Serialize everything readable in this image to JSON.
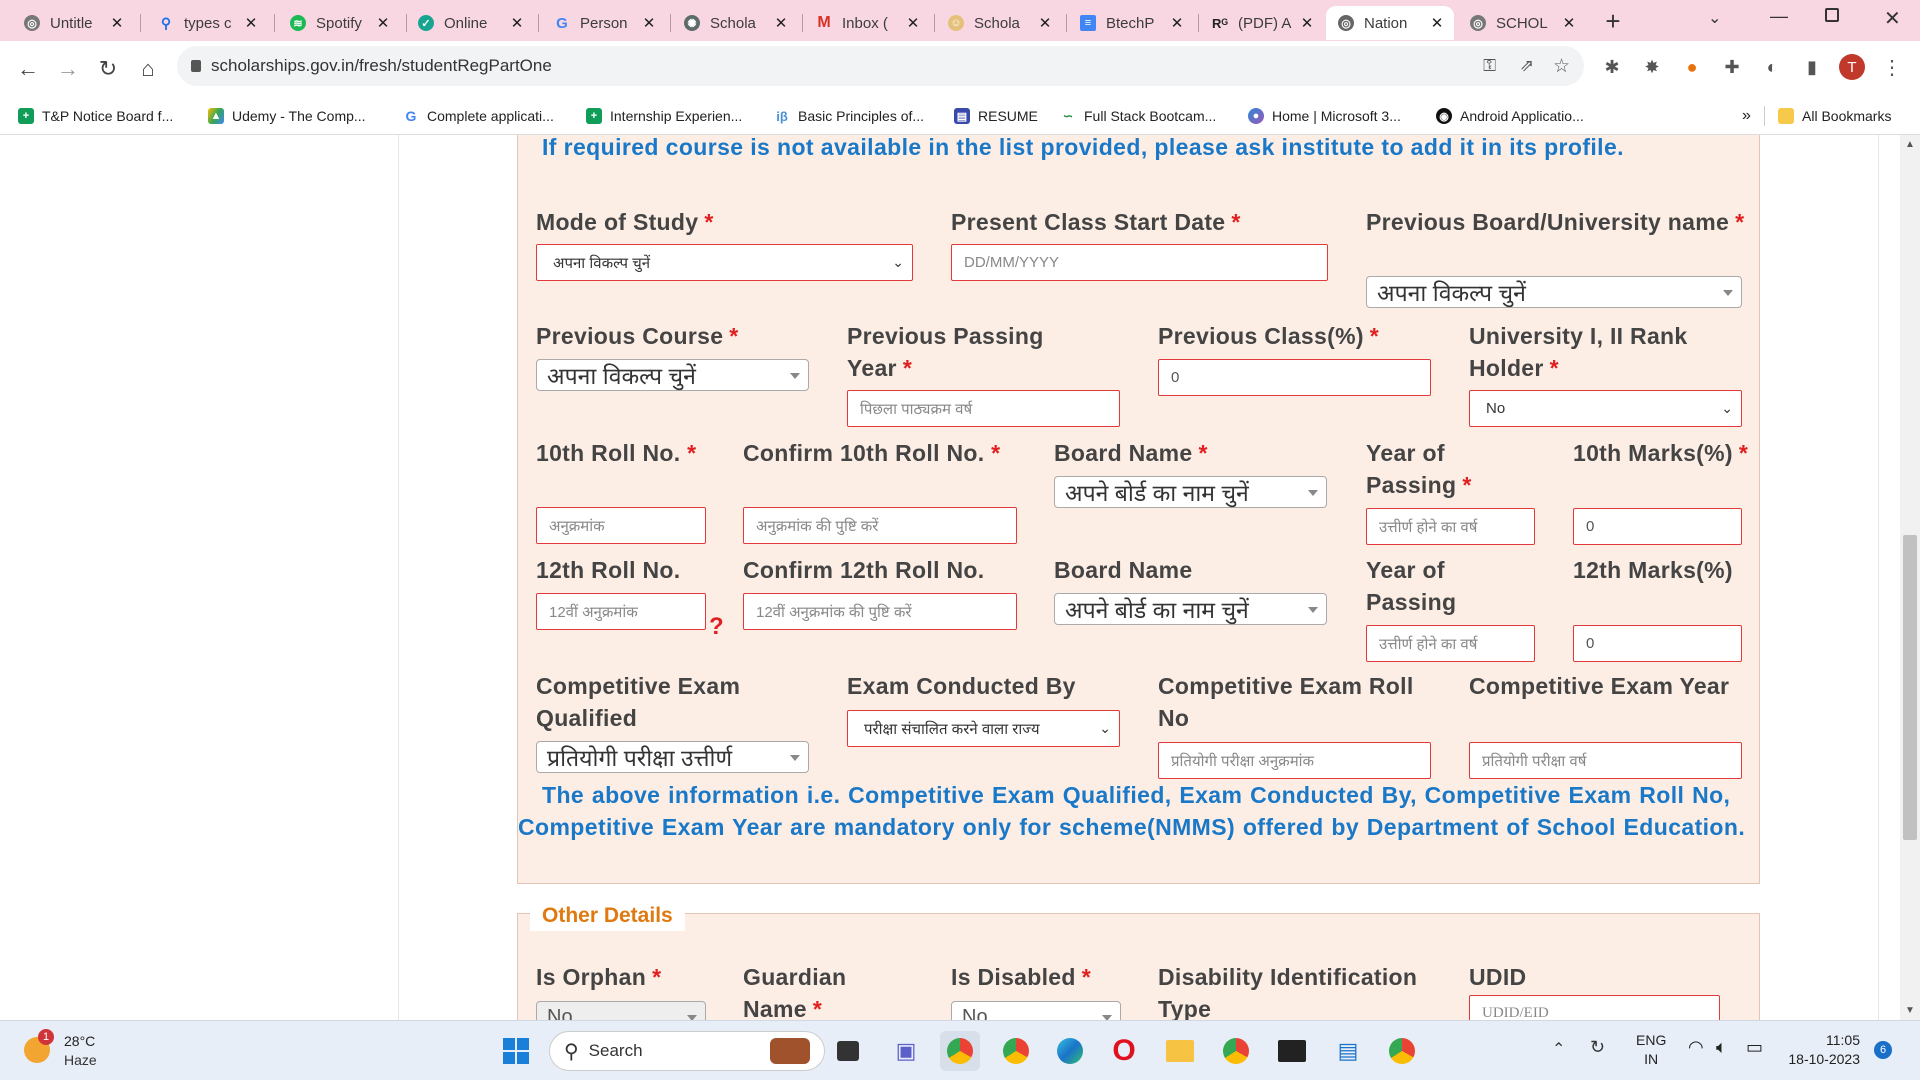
{
  "tabs": [
    {
      "title": "Untitle",
      "icon": "globe-icon"
    },
    {
      "title": "types c",
      "icon": "search-icon"
    },
    {
      "title": "Spotify",
      "icon": "spotify-icon"
    },
    {
      "title": "Online",
      "icon": "online-icon"
    },
    {
      "title": "Person",
      "icon": "google-icon"
    },
    {
      "title": "Schola",
      "icon": "chatgpt-icon"
    },
    {
      "title": "Inbox (",
      "icon": "gmail-icon"
    },
    {
      "title": "Schola",
      "icon": "scholar-icon"
    },
    {
      "title": "BtechP",
      "icon": "docs-icon"
    },
    {
      "title": "(PDF) A",
      "icon": "researchgate-icon"
    },
    {
      "title": "Nation",
      "icon": "globe-icon",
      "active": true
    },
    {
      "title": "SCHOL",
      "icon": "globe-icon"
    }
  ],
  "address": {
    "url": "scholarships.gov.in/fresh/studentRegPartOne"
  },
  "profile_initial": "T",
  "bookmarks": [
    {
      "label": "T&P Notice Board f...",
      "icon": "sheets-icon"
    },
    {
      "label": "Udemy - The Comp...",
      "icon": "drive-icon"
    },
    {
      "label": "Complete applicati...",
      "icon": "google-icon"
    },
    {
      "label": "Internship Experien...",
      "icon": "sheets-icon"
    },
    {
      "label": "Basic Principles of...",
      "icon": "ib-icon"
    },
    {
      "label": "RESUME",
      "icon": "resume-icon"
    },
    {
      "label": "Full Stack Bootcam...",
      "icon": "geeks-icon"
    },
    {
      "label": "Home | Microsoft 3...",
      "icon": "microsoft-icon"
    },
    {
      "label": "Android Applicatio...",
      "icon": "github-icon"
    }
  ],
  "all_bookmarks": "All Bookmarks",
  "bookmarks_overflow": "»",
  "form": {
    "course_note": "If required course is not available in the list provided, please ask institute to add it in its profile.",
    "required_mark": "*",
    "mode_of_study": {
      "label": "Mode of Study",
      "value": "अपना विकल्प चुनें"
    },
    "present_class_start": {
      "label": "Present Class Start Date",
      "placeholder": "DD/MM/YYYY"
    },
    "prev_board": {
      "label": "Previous Board/University name",
      "value": "अपना विकल्प चुनें"
    },
    "prev_course": {
      "label": "Previous Course",
      "value": "अपना विकल्प चुनें"
    },
    "prev_passing_year": {
      "label": "Previous Passing Year",
      "placeholder": "पिछला पाठ्यक्रम वर्ष"
    },
    "prev_class_pct": {
      "label": "Previous Class(%)",
      "value": "0"
    },
    "rank_holder": {
      "label": "University I, II Rank Holder",
      "value": "No"
    },
    "roll10": {
      "label": "10th Roll No.",
      "placeholder": "अनुक्रमांक"
    },
    "confirm_roll10": {
      "label": "Confirm 10th Roll No.",
      "placeholder": "अनुक्रमांक की पुष्टि करें"
    },
    "board10": {
      "label": "Board Name",
      "value": "अपने बोर्ड का नाम चुनें"
    },
    "year10": {
      "label": "Year of Passing",
      "placeholder": "उत्तीर्ण होने का वर्ष"
    },
    "marks10": {
      "label": "10th Marks(%)",
      "value": "0"
    },
    "roll12": {
      "label": "12th Roll No.",
      "placeholder": "12वीं अनुक्रमांक"
    },
    "help_mark": "?",
    "confirm_roll12": {
      "label": "Confirm 12th Roll No.",
      "placeholder": "12वीं अनुक्रमांक की पुष्टि करें"
    },
    "board12": {
      "label": "Board Name",
      "value": "अपने बोर्ड का नाम चुनें"
    },
    "year12": {
      "label": "Year of Passing",
      "placeholder": "उत्तीर्ण होने का वर्ष"
    },
    "marks12": {
      "label": "12th Marks(%)",
      "value": "0"
    },
    "comp_exam": {
      "label": "Competitive Exam Qualified",
      "value": "प्रतियोगी परीक्षा उत्तीर्ण"
    },
    "exam_by": {
      "label": "Exam Conducted By",
      "value": "परीक्षा संचालित करने वाला राज्य"
    },
    "comp_roll": {
      "label": "Competitive Exam Roll No",
      "placeholder": "प्रतियोगी परीक्षा अनुक्रमांक"
    },
    "comp_year": {
      "label": "Competitive Exam Year",
      "placeholder": "प्रतियोगी परीक्षा वर्ष"
    },
    "comp_note": "The above information i.e. Competitive Exam Qualified, Exam Conducted By, Competitive Exam Roll No, Competitive Exam Year are mandatory only for scheme(NMMS) offered by Department of School Education."
  },
  "other": {
    "legend": "Other Details",
    "is_orphan": {
      "label": "Is Orphan",
      "value": "No"
    },
    "guardian_name": {
      "label": "Guardian Name"
    },
    "is_disabled": {
      "label": "Is Disabled",
      "value": "No"
    },
    "disability_type": {
      "label": "Disability Identification Type"
    },
    "udid": {
      "label": "UDID",
      "placeholder": "UDID/EID"
    }
  },
  "taskbar": {
    "weather_temp": "28°C",
    "weather_desc": "Haze",
    "weather_badge": "1",
    "search": "Search",
    "lang1": "ENG",
    "lang2": "IN",
    "time": "11:05",
    "date": "18-10-2023",
    "notif": "6"
  },
  "colors": {
    "note_blue": "#1978c8",
    "legend_orange": "#e07a10",
    "required_red": "#e02020",
    "form_bg": "#fdeee5",
    "tab_strip": "#f8d7e3"
  }
}
